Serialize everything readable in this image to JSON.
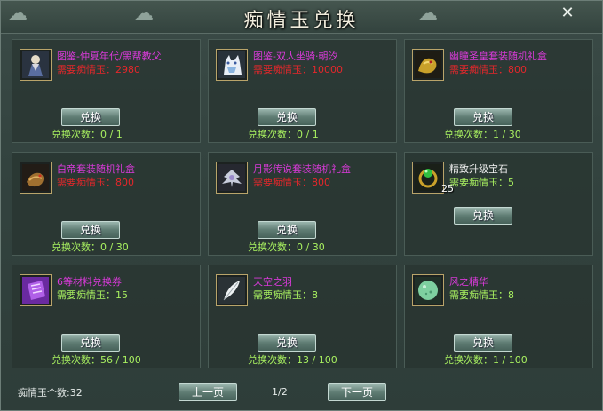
{
  "window": {
    "title": "痴情玉兑换"
  },
  "items": [
    {
      "name": "图鉴-仲夏年代/黑帮教父",
      "name_color": "purple",
      "requirement": "需要痴情玉：2980",
      "req_color": "red",
      "button_label": "兑换",
      "times": "兑换次数：0 / 1",
      "icon": "costume-figure-icon"
    },
    {
      "name": "图鉴-双人坐骑·朝汐",
      "name_color": "purple",
      "requirement": "需要痴情玉：10000",
      "req_color": "red",
      "button_label": "兑换",
      "times": "兑换次数：0 / 1",
      "icon": "white-wolf-mount-icon"
    },
    {
      "name": "幽瞳圣皇套装随机礼盒",
      "name_color": "purple",
      "requirement": "需要痴情玉：800",
      "req_color": "red",
      "button_label": "兑换",
      "times": "兑换次数：1 / 30",
      "icon": "golden-dragon-box-icon"
    },
    {
      "name": "白帝套装随机礼盒",
      "name_color": "purple",
      "requirement": "需要痴情玉：800",
      "req_color": "red",
      "button_label": "兑换",
      "times": "兑换次数：0 / 30",
      "icon": "dragon-gift-box-icon"
    },
    {
      "name": "月影传说套装随机礼盒",
      "name_color": "purple",
      "requirement": "需要痴情玉：800",
      "req_color": "red",
      "button_label": "兑换",
      "times": "兑换次数：0 / 30",
      "icon": "silver-wing-box-icon"
    },
    {
      "name": "精致升级宝石",
      "name_color": "white",
      "requirement": "需要痴情玉：5",
      "req_color": "green",
      "button_label": "兑换",
      "times": "",
      "icon": "green-gem-ring-icon",
      "count": "25"
    },
    {
      "name": "6等材料兑换券",
      "name_color": "purple",
      "requirement": "需要痴情玉：15",
      "req_color": "green",
      "button_label": "兑换",
      "times": "兑换次数：56 / 100",
      "icon": "purple-ticket-icon"
    },
    {
      "name": "天空之羽",
      "name_color": "purple",
      "requirement": "需要痴情玉：8",
      "req_color": "green",
      "button_label": "兑换",
      "times": "兑换次数：13 / 100",
      "icon": "white-feather-icon"
    },
    {
      "name": "风之精华",
      "name_color": "purple",
      "requirement": "需要痴情玉：8",
      "req_color": "green",
      "button_label": "兑换",
      "times": "兑换次数：1 / 100",
      "icon": "jade-orb-icon"
    }
  ],
  "footer": {
    "count_label": "痴情玉个数:32",
    "prev_label": "上一页",
    "page_indicator": "1/2",
    "next_label": "下一页"
  },
  "close_glyph": "✕"
}
